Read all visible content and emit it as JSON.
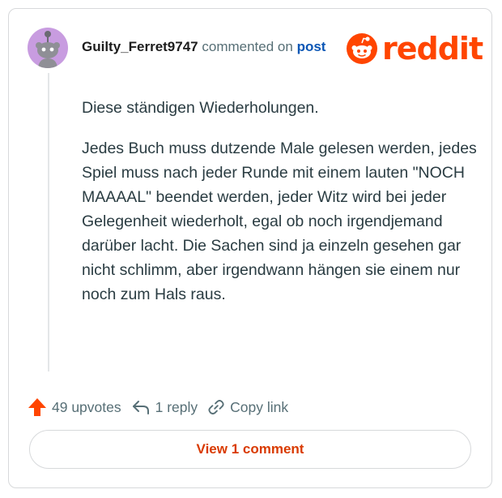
{
  "comment": {
    "username": "Guilty_Ferret9747",
    "commented_on": "commented on",
    "post_link": "post",
    "paragraphs": [
      "Diese ständigen Wiederholungen.",
      "Jedes Buch muss dutzende Male gelesen werden, jedes Spiel muss nach jeder Runde mit einem lauten \"NOCH MAAAAL\" beendet werden, jeder Witz wird bei jeder Gelegenheit wiederholt, egal ob noch irgendjemand darüber lacht. Die Sachen sind ja einzeln gesehen gar nicht schlimm, aber irgendwann hängen sie einem nur noch zum Hals raus."
    ]
  },
  "brand": {
    "name": "reddit",
    "color": "#ff4500"
  },
  "actions": {
    "upvotes": "49 upvotes",
    "replies": "1 reply",
    "copy_link": "Copy link"
  },
  "view_button": "View 1 comment",
  "colors": {
    "avatar_bg": "#c89ce0",
    "upvote": "#ff4500",
    "link_blue": "#0a56b5",
    "button_text": "#d93a00"
  },
  "icons": [
    "avatar-snoo-icon",
    "reddit-logo-icon",
    "upvote-arrow-icon",
    "reply-arrow-icon",
    "link-icon"
  ]
}
